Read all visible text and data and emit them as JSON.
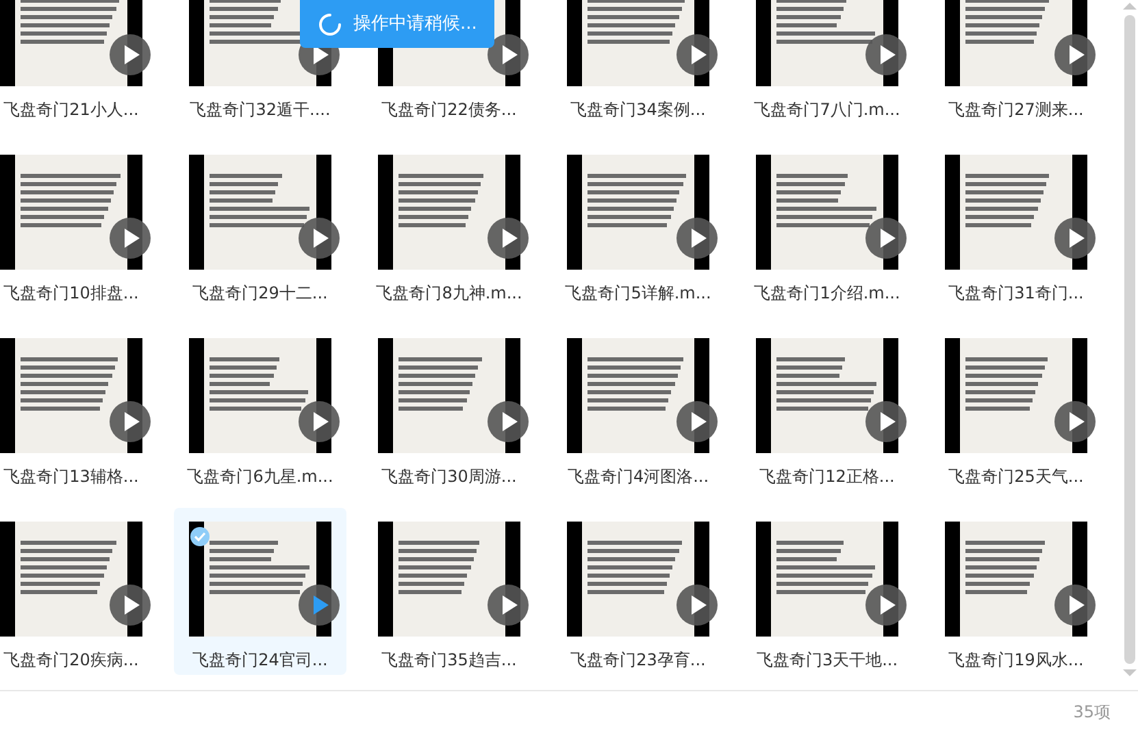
{
  "toast": {
    "text": "操作中请稍候..."
  },
  "items": [
    {
      "name": "飞盘奇门21小人...",
      "selected": false
    },
    {
      "name": "飞盘奇门32遁干....",
      "selected": false
    },
    {
      "name": "飞盘奇门22债务...",
      "selected": false
    },
    {
      "name": "飞盘奇门34案例...",
      "selected": false
    },
    {
      "name": "飞盘奇门7八门.m...",
      "selected": false
    },
    {
      "name": "飞盘奇门27测来...",
      "selected": false
    },
    {
      "name": "飞盘奇门10排盘...",
      "selected": false
    },
    {
      "name": "飞盘奇门29十二...",
      "selected": false
    },
    {
      "name": "飞盘奇门8九神.m...",
      "selected": false
    },
    {
      "name": "飞盘奇门5详解.m...",
      "selected": false
    },
    {
      "name": "飞盘奇门1介绍.m...",
      "selected": false
    },
    {
      "name": "飞盘奇门31奇门...",
      "selected": false
    },
    {
      "name": "飞盘奇门13辅格...",
      "selected": false
    },
    {
      "name": "飞盘奇门6九星.m...",
      "selected": false
    },
    {
      "name": "飞盘奇门30周游...",
      "selected": false
    },
    {
      "name": "飞盘奇门4河图洛...",
      "selected": false
    },
    {
      "name": "飞盘奇门12正格...",
      "selected": false
    },
    {
      "name": "飞盘奇门25天气...",
      "selected": false
    },
    {
      "name": "飞盘奇门20疾病...",
      "selected": false
    },
    {
      "name": "飞盘奇门24官司...",
      "selected": true
    },
    {
      "name": "飞盘奇门35趋吉...",
      "selected": false
    },
    {
      "name": "飞盘奇门23孕育...",
      "selected": false
    },
    {
      "name": "飞盘奇门3天干地...",
      "selected": false
    },
    {
      "name": "飞盘奇门19风水...",
      "selected": false
    }
  ],
  "status_bar": {
    "count": "35项"
  }
}
